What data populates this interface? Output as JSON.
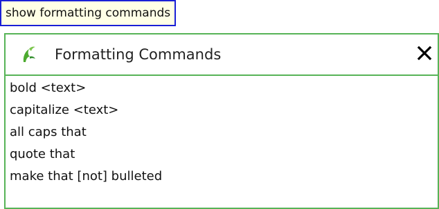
{
  "recognized_phrase": "show formatting commands",
  "panel": {
    "icon": "dragon-icon",
    "title": "Formatting Commands",
    "close_icon": "close-icon",
    "commands": [
      "bold <text>",
      "capitalize <text>",
      "all caps that",
      "quote that",
      "make that [not] bulleted"
    ]
  },
  "colors": {
    "phrase_border": "#1a1fd6",
    "phrase_background": "#ffffe6",
    "panel_border": "#56b356",
    "icon_green": "#4caa2f"
  }
}
